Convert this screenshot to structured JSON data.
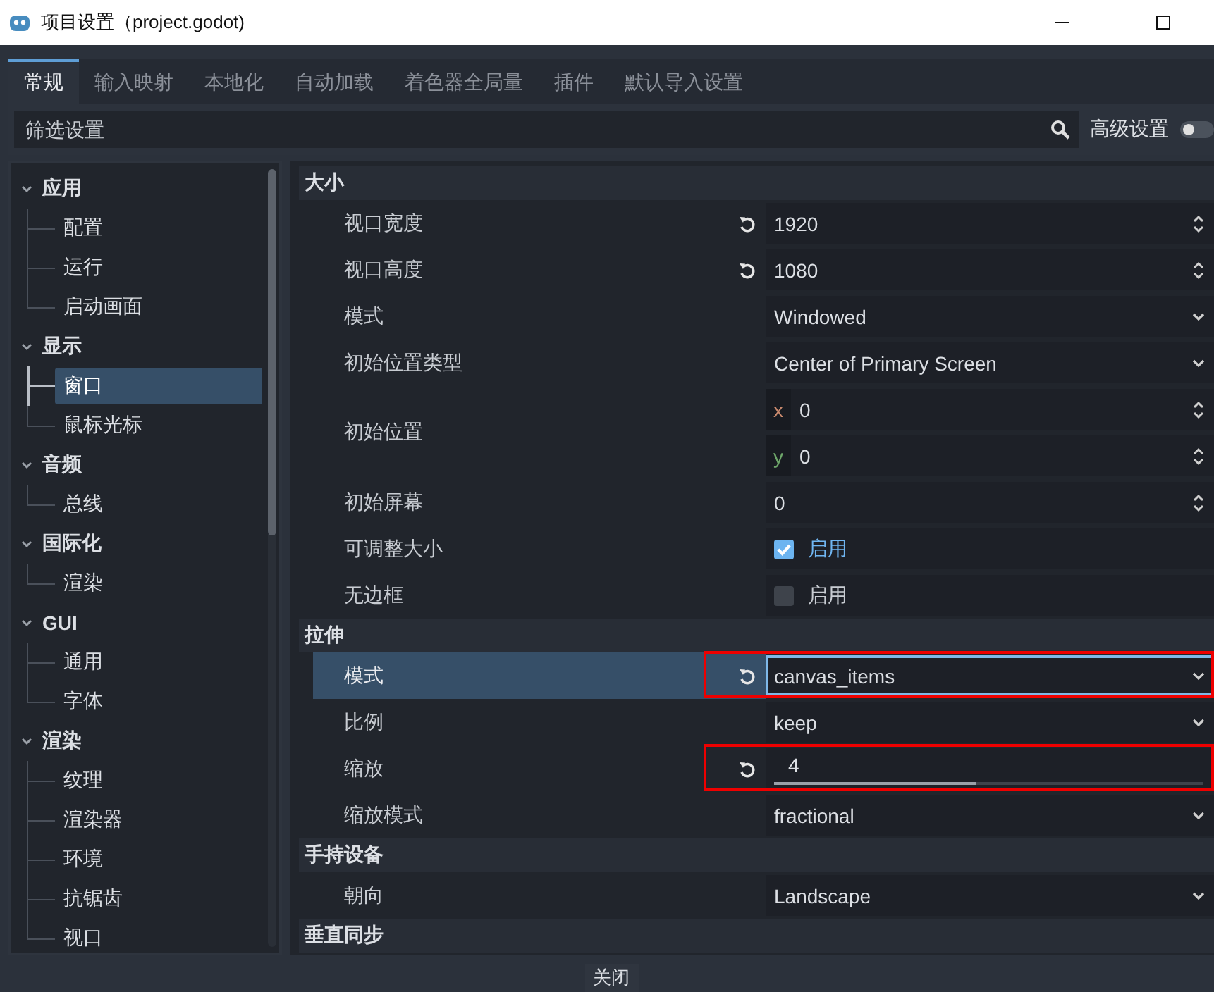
{
  "window": {
    "title": "项目设置（project.godot)"
  },
  "tabs": [
    {
      "label": "常规",
      "selected": true
    },
    {
      "label": "输入映射",
      "selected": false
    },
    {
      "label": "本地化",
      "selected": false
    },
    {
      "label": "自动加载",
      "selected": false
    },
    {
      "label": "着色器全局量",
      "selected": false
    },
    {
      "label": "插件",
      "selected": false
    },
    {
      "label": "默认导入设置",
      "selected": false
    }
  ],
  "filter": {
    "placeholder": "筛选设置"
  },
  "advanced": {
    "label": "高级设置",
    "on": false
  },
  "sidebar": {
    "sections": [
      {
        "label": "应用",
        "expanded": true,
        "children": [
          {
            "label": "配置",
            "selected": false
          },
          {
            "label": "运行",
            "selected": false
          },
          {
            "label": "启动画面",
            "selected": false
          }
        ]
      },
      {
        "label": "显示",
        "expanded": true,
        "children": [
          {
            "label": "窗口",
            "selected": true
          },
          {
            "label": "鼠标光标",
            "selected": false
          }
        ]
      },
      {
        "label": "音频",
        "expanded": true,
        "children": [
          {
            "label": "总线",
            "selected": false
          }
        ]
      },
      {
        "label": "国际化",
        "expanded": true,
        "children": [
          {
            "label": "渲染",
            "selected": false
          }
        ]
      },
      {
        "label": "GUI",
        "expanded": true,
        "children": [
          {
            "label": "通用",
            "selected": false
          },
          {
            "label": "字体",
            "selected": false
          }
        ]
      },
      {
        "label": "渲染",
        "expanded": true,
        "children": [
          {
            "label": "纹理",
            "selected": false
          },
          {
            "label": "渲染器",
            "selected": false
          },
          {
            "label": "环境",
            "selected": false
          },
          {
            "label": "抗锯齿",
            "selected": false
          },
          {
            "label": "视口",
            "selected": false
          }
        ]
      }
    ]
  },
  "settings": {
    "sections": [
      {
        "title": "大小",
        "rows": [
          {
            "label": "视口宽度",
            "kind": "spin",
            "value": "1920",
            "revertable": true,
            "selected": false,
            "highlighted": false
          },
          {
            "label": "视口高度",
            "kind": "spin",
            "value": "1080",
            "revertable": true,
            "selected": false,
            "highlighted": false
          },
          {
            "label": "模式",
            "kind": "dropdown",
            "value": "Windowed",
            "revertable": false,
            "selected": false,
            "highlighted": false
          },
          {
            "label": "初始位置类型",
            "kind": "dropdown",
            "value": "Center of Primary Screen",
            "revertable": false,
            "selected": false,
            "highlighted": false
          },
          {
            "label": "初始位置",
            "kind": "vector",
            "components": [
              {
                "axis": "x",
                "value": "0",
                "color": "#c98a6e"
              },
              {
                "axis": "y",
                "value": "0",
                "color": "#6ea76a"
              }
            ],
            "revertable": false,
            "selected": false,
            "highlighted": false
          },
          {
            "label": "初始屏幕",
            "kind": "spin",
            "value": "0",
            "revertable": false,
            "selected": false,
            "highlighted": false
          },
          {
            "label": "可调整大小",
            "kind": "check",
            "checked": true,
            "text": "启用",
            "revertable": false,
            "selected": false,
            "highlighted": false
          },
          {
            "label": "无边框",
            "kind": "check",
            "checked": false,
            "text": "启用",
            "revertable": false,
            "selected": false,
            "highlighted": false
          }
        ]
      },
      {
        "title": "拉伸",
        "rows": [
          {
            "label": "模式",
            "kind": "dropdown",
            "value": "canvas_items",
            "revertable": true,
            "selected": true,
            "highlighted": true
          },
          {
            "label": "比例",
            "kind": "dropdown",
            "value": "keep",
            "revertable": false,
            "selected": false,
            "highlighted": false
          },
          {
            "label": "缩放",
            "kind": "slider",
            "value": "4",
            "level": 0.47,
            "revertable": true,
            "selected": false,
            "highlighted": true
          },
          {
            "label": "缩放模式",
            "kind": "dropdown",
            "value": "fractional",
            "revertable": false,
            "selected": false,
            "highlighted": false
          }
        ]
      },
      {
        "title": "手持设备",
        "rows": [
          {
            "label": "朝向",
            "kind": "dropdown",
            "value": "Landscape",
            "revertable": false,
            "selected": false,
            "highlighted": false
          }
        ]
      },
      {
        "title": "垂直同步"
      }
    ]
  },
  "footer": {
    "close_button": "关闭"
  }
}
